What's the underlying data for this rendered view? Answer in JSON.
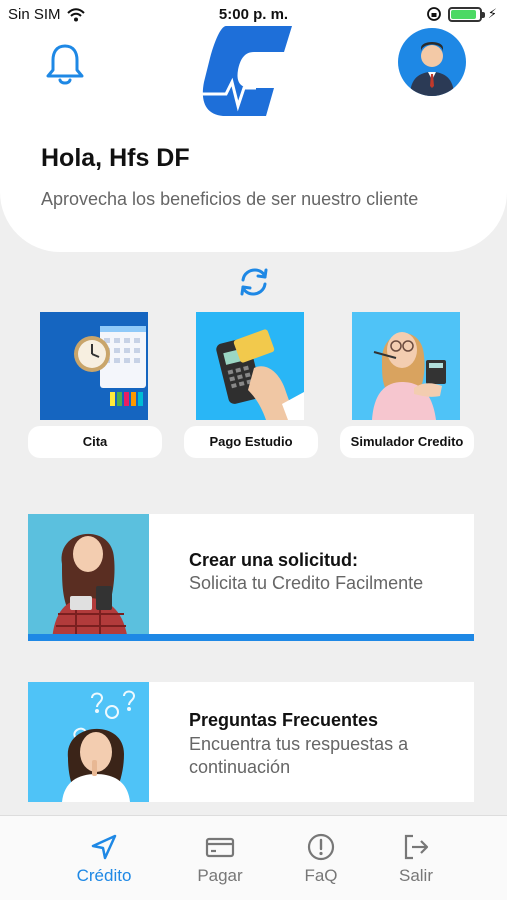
{
  "status_bar": {
    "carrier": "Sin SIM",
    "time": "5:00 p. m.",
    "battery_level": 0.9
  },
  "header": {
    "greeting": "Hola, Hfs DF",
    "subtitle": "Aprovecha los beneficios de ser nuestro cliente",
    "logo_letter": "C"
  },
  "tiles": [
    {
      "label": "Cita",
      "icon": "calendar-clock-image"
    },
    {
      "label": "Pago Estudio",
      "icon": "card-payment-image"
    },
    {
      "label": "Simulador Credito",
      "icon": "woman-calculator-image"
    }
  ],
  "cards": [
    {
      "title": "Crear una solicitud:",
      "text": "Solicita tu Credito Facilmente"
    },
    {
      "title": "Preguntas Frecuentes",
      "text": "Encuentra tus respuestas a continuación"
    }
  ],
  "tabs": [
    {
      "label": "Crédito",
      "icon": "navigation-arrow-icon",
      "active": true
    },
    {
      "label": "Pagar",
      "icon": "credit-card-icon",
      "active": false
    },
    {
      "label": "FaQ",
      "icon": "alert-circle-icon",
      "active": false
    },
    {
      "label": "Salir",
      "icon": "logout-icon",
      "active": false
    }
  ],
  "colors": {
    "accent": "#1e88e5",
    "background": "#efefef",
    "card": "#ffffff",
    "muted_text": "#666666"
  }
}
